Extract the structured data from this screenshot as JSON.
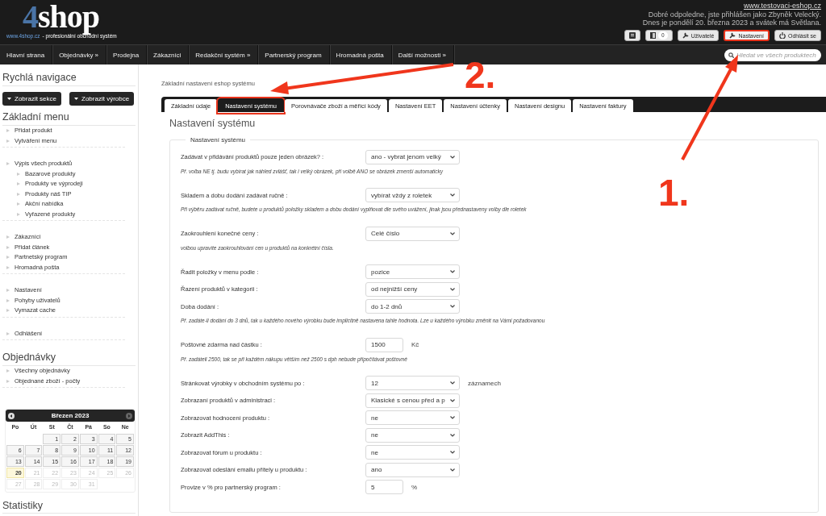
{
  "header": {
    "logo": "4shop",
    "tagline_link": "www.4shop.cz",
    "tagline": "- profesionální obchodní systém",
    "site_link": "www.testovaci-eshop.cz",
    "greeting": "Dobré odpoledne, jste přihlášen jako Zbyněk Velecký.",
    "date_line": "Dnes je pondělí 20. března 2023 a svátek má Světlana.",
    "buttons": [
      {
        "kind": "icon",
        "highlighted": false
      },
      {
        "kind": "badge",
        "badge": "0",
        "highlighted": false
      },
      {
        "kind": "users",
        "label": "Uživatelé",
        "highlighted": false
      },
      {
        "kind": "wrench",
        "label": "Nastavení",
        "highlighted": true
      },
      {
        "kind": "power",
        "label": "Odhlásit se",
        "highlighted": false
      }
    ]
  },
  "nav": {
    "items": [
      "Hlavní strana",
      "Objednávky »",
      "Prodejna",
      "Zákazníci",
      "Redakční systém »",
      "Partnerský program",
      "Hromadná pošta",
      "Další možnosti »"
    ],
    "search": {
      "placeholder": "Hledat ve všech produktech"
    }
  },
  "sidebar": {
    "quick_nav": {
      "title": "Rychlá navigace",
      "buttons": [
        "Zobrazit sekce",
        "Zobrazit výrobce"
      ]
    },
    "sections": [
      {
        "title": "Základní menu",
        "groups": [
          [
            {
              "label": "Přidat produkt"
            },
            {
              "label": "Vytváření menu"
            }
          ],
          [
            {
              "label": "Výpis všech produktů",
              "children": [
                {
                  "label": "Bazarové produkty"
                },
                {
                  "label": "Produkty ve výprodeji"
                },
                {
                  "label": "Produkty náš TIP"
                },
                {
                  "label": "Akční nabídka"
                },
                {
                  "label": "Vyřazené produkty"
                }
              ]
            }
          ],
          [
            {
              "label": "Zákazníci"
            },
            {
              "label": "Přidat článek"
            },
            {
              "label": "Partnetský program"
            },
            {
              "label": "Hromadná pošta"
            }
          ],
          [
            {
              "label": "Nastavení"
            },
            {
              "label": "Pohyby uživatelů"
            },
            {
              "label": "Vymazat cache"
            }
          ],
          [
            {
              "label": "Odhlášení"
            }
          ]
        ]
      },
      {
        "title": "Objednávky",
        "groups": [
          [
            {
              "label": "Všechny objednávky"
            },
            {
              "label": "Objednané zboží - počty"
            }
          ]
        ]
      }
    ],
    "calendar": {
      "title": "Březen 2023",
      "weekdays": [
        "Po",
        "Út",
        "St",
        "Čt",
        "Pá",
        "So",
        "Ne"
      ],
      "weeks": [
        [
          {
            "kind": "blank"
          },
          {
            "kind": "blank"
          },
          {
            "day": "1",
            "kind": "past"
          },
          {
            "day": "2",
            "kind": "past"
          },
          {
            "day": "3",
            "kind": "past"
          },
          {
            "day": "4",
            "kind": "past"
          },
          {
            "day": "5",
            "kind": "past"
          }
        ],
        [
          {
            "day": "6",
            "kind": "past"
          },
          {
            "day": "7",
            "kind": "past"
          },
          {
            "day": "8",
            "kind": "past"
          },
          {
            "day": "9",
            "kind": "past"
          },
          {
            "day": "10",
            "kind": "past"
          },
          {
            "day": "11",
            "kind": "past"
          },
          {
            "day": "12",
            "kind": "past"
          }
        ],
        [
          {
            "day": "13",
            "kind": "past"
          },
          {
            "day": "14",
            "kind": "past"
          },
          {
            "day": "15",
            "kind": "past"
          },
          {
            "day": "16",
            "kind": "past"
          },
          {
            "day": "17",
            "kind": "past"
          },
          {
            "day": "18",
            "kind": "past"
          },
          {
            "day": "19",
            "kind": "past"
          }
        ],
        [
          {
            "day": "20",
            "kind": "today"
          },
          {
            "day": "21",
            "kind": "future"
          },
          {
            "day": "22",
            "kind": "future"
          },
          {
            "day": "23",
            "kind": "future"
          },
          {
            "day": "24",
            "kind": "future"
          },
          {
            "day": "25",
            "kind": "future"
          },
          {
            "day": "26",
            "kind": "future"
          }
        ],
        [
          {
            "day": "27",
            "kind": "future"
          },
          {
            "day": "28",
            "kind": "future"
          },
          {
            "day": "29",
            "kind": "future"
          },
          {
            "day": "30",
            "kind": "future"
          },
          {
            "day": "31",
            "kind": "future"
          },
          {
            "kind": "blank"
          },
          {
            "kind": "blank"
          }
        ]
      ]
    },
    "stats_title": "Statistiky"
  },
  "main": {
    "breadcrumb": "Základní nastavení eshop systému",
    "tabs": [
      {
        "label": "Základní údaje",
        "selected": false,
        "highlighted": false
      },
      {
        "label": "Nastavení systému",
        "selected": true,
        "highlighted": true
      },
      {
        "label": "Porovnávače zboží a měřící kódy",
        "selected": false,
        "highlighted": false
      },
      {
        "label": "Nastavení EET",
        "selected": false,
        "highlighted": false
      },
      {
        "label": "Nastavení účtenky",
        "selected": false,
        "highlighted": false
      },
      {
        "label": "Nastavení designu",
        "selected": false,
        "highlighted": false
      },
      {
        "label": "Nastavení faktury",
        "selected": false,
        "highlighted": false
      }
    ],
    "title": "Nastavení systému",
    "fieldset": {
      "legend": "Nastavení systému",
      "groups": [
        {
          "rows": [
            {
              "kind": "select",
              "label": "Zadávat v přidávání produktů pouze jeden obrázek? :",
              "value": "ano - vybrat jenom velký"
            }
          ],
          "note": "Př. volba NE tj. budu vybírat jak náhled zvlášť, tak i velký obrázek, při volbě ANO se obrázek zmenší automaticky"
        },
        {
          "rows": [
            {
              "kind": "select",
              "label": "Skladem a dobu dodání zadávat ručně :",
              "value": "vybírat vždy z roletek"
            }
          ],
          "note": "Při výběru zadávat ručně, budete u produktů položky skladem a dobu dodání vyplňovat dle svého uvážení, jinak jsou přednastaveny volby dle roletek"
        },
        {
          "rows": [
            {
              "kind": "select",
              "label": "Zaokrouhlení konečné ceny :",
              "value": "Celé číslo"
            }
          ],
          "note": "volbou upravíte zaokrouhlování cen u produktů na konkrétní čísla."
        },
        {
          "rows": [
            {
              "kind": "select",
              "label": "Řadit položky v menu podle :",
              "value": "pozice"
            },
            {
              "kind": "select",
              "label": "Řazení produktů v kategorii :",
              "value": "od nejnižší ceny"
            },
            {
              "kind": "select",
              "label": "Doba dodání :",
              "value": "do 1-2 dnů"
            }
          ],
          "note": "Př. zadáte-li dodání do 3 dnů, tak u každého nového výrobku bude implicitně nastavena tahle hodnota. Lze u každého výrobku změnit na Vámi požadovanou"
        },
        {
          "rows": [
            {
              "kind": "input",
              "label": "Poštovné zdarma nad částku :",
              "value": "1500",
              "unit": "Kč"
            }
          ],
          "note": "Př. zadáteli 2500, tak se při každém nákupu větším než 2500 s dph nebude připočítávat poštovné"
        },
        {
          "rows": [
            {
              "kind": "select",
              "label": "Stránkovat výrobky v obchodním systému po :",
              "value": "12",
              "unit": "záznamech"
            },
            {
              "kind": "select",
              "label": "Zobrazaní produktů v administraci :",
              "value": "Klasické s cenou před a p"
            },
            {
              "kind": "select",
              "label": "Zobrazovat hodnocení produktu :",
              "value": "ne"
            },
            {
              "kind": "select",
              "label": "Zobrazit AddThis :",
              "value": "ne"
            },
            {
              "kind": "select",
              "label": "Zobrazovat fórum u produktu :",
              "value": "ne"
            },
            {
              "kind": "select",
              "label": "Zobrazovat odeslání emailu přítely u produktu :",
              "value": "ano"
            },
            {
              "kind": "input",
              "label": "Provize v % pro partnerský program :",
              "value": "5",
              "unit": "%"
            }
          ]
        }
      ]
    }
  },
  "annotations": [
    {
      "kind": "tab-pointer",
      "label": "2."
    },
    {
      "kind": "button-pointer",
      "label": "1."
    }
  ]
}
